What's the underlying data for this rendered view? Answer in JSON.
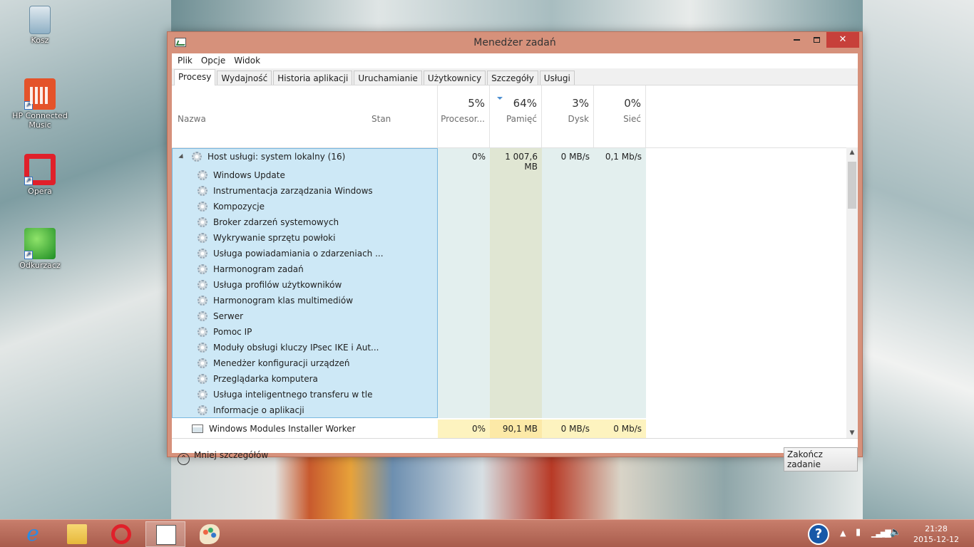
{
  "desktop": {
    "icons": [
      {
        "label": "Kosz"
      },
      {
        "label": "HP Connected Music"
      },
      {
        "label": "Opera"
      },
      {
        "label": "Odkurzacz"
      }
    ]
  },
  "window": {
    "title": "Menedżer zadań",
    "close_glyph": "✕"
  },
  "menu": [
    "Plik",
    "Opcje",
    "Widok"
  ],
  "tabs": [
    "Procesy",
    "Wydajność",
    "Historia aplikacji",
    "Uruchamianie",
    "Użytkownicy",
    "Szczegóły",
    "Usługi"
  ],
  "active_tab": "Procesy",
  "columns": {
    "name": "Nazwa",
    "status": "Stan",
    "cpu": {
      "percent": "5%",
      "label": "Procesor..."
    },
    "memory": {
      "percent": "64%",
      "label": "Pamięć"
    },
    "disk": {
      "percent": "3%",
      "label": "Dysk"
    },
    "network": {
      "percent": "0%",
      "label": "Sieć"
    }
  },
  "group": {
    "name": "Host usługi: system lokalny (16)",
    "cpu": "0%",
    "memory": "1 007,6 MB",
    "disk": "0 MB/s",
    "network": "0,1 Mb/s",
    "services": [
      "Windows Update",
      "Instrumentacja zarządzania Windows",
      "Kompozycje",
      "Broker zdarzeń systemowych",
      "Wykrywanie sprzętu powłoki",
      "Usługa powiadamiania o zdarzeniach ...",
      "Harmonogram zadań",
      "Usługa profilów użytkowników",
      "Harmonogram klas multimediów",
      "Serwer",
      "Pomoc IP",
      "Moduły obsługi kluczy IPsec IKE i Aut...",
      "Menedżer konfiguracji urządzeń",
      "Przeglądarka komputera",
      "Usługa inteligentnego transferu w tle",
      "Informacje o aplikacji"
    ]
  },
  "process": {
    "name": "Windows Modules Installer Worker",
    "cpu": "0%",
    "memory": "90,1 MB",
    "disk": "0 MB/s",
    "network": "0 Mb/s"
  },
  "footer": {
    "fewer_details": "Mniej szczegółów",
    "end_task": "Zakończ zadanie"
  },
  "taskbar": {
    "apps": [
      "ie-icon",
      "file-explorer-icon",
      "opera-icon",
      "task-manager-icon",
      "paint-icon"
    ],
    "time": "21:28",
    "date": "2015-12-12"
  },
  "colors": {
    "window_frame": "#d6917b",
    "close_button": "#c7403a",
    "selection": "#cde8f6",
    "memory_heat": "#e0e6d3",
    "cpu_heat": "#e3efee",
    "highlight_row": "#fdf3bf"
  }
}
